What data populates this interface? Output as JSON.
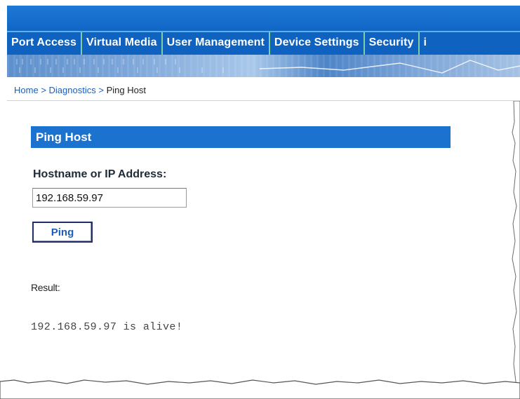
{
  "nav": {
    "tabs": [
      {
        "label": "Port Access"
      },
      {
        "label": "Virtual Media"
      },
      {
        "label": "User Management"
      },
      {
        "label": "Device Settings"
      },
      {
        "label": "Security"
      },
      {
        "label": "i"
      }
    ]
  },
  "breadcrumb": {
    "home": "Home",
    "separator": ">",
    "diagnostics": "Diagnostics",
    "current": "Ping Host"
  },
  "ping": {
    "section_title": "Ping Host",
    "field_label": "Hostname or IP Address:",
    "ip_value": "192.168.59.97",
    "button_label": "Ping",
    "result_label": "Result:",
    "result_text": "192.168.59.97 is alive!"
  },
  "colors": {
    "header_blue": "#1166c4",
    "section_blue": "#1b72cf",
    "link_blue": "#1b5fb8",
    "tab_divider_green": "#7fd0a0"
  }
}
